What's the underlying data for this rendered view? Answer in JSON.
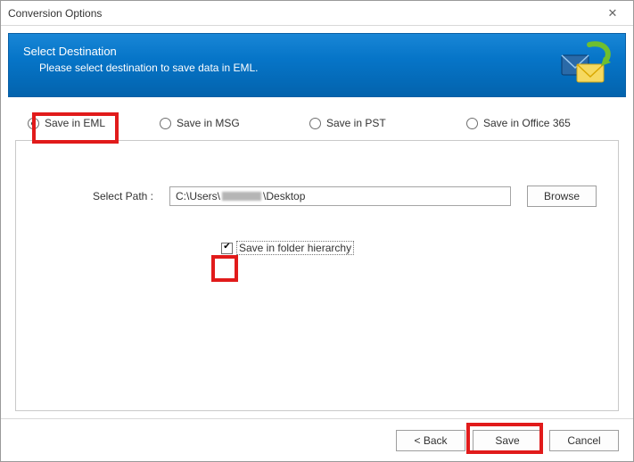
{
  "window": {
    "title": "Conversion Options"
  },
  "header": {
    "title": "Select Destination",
    "subtitle": "Please select destination to save data in EML."
  },
  "options": {
    "opt1": {
      "label": "Save in EML",
      "selected": true
    },
    "opt2": {
      "label": "Save in MSG",
      "selected": false
    },
    "opt3": {
      "label": "Save in PST",
      "selected": false
    },
    "opt4": {
      "label": "Save in Office 365",
      "selected": false
    }
  },
  "path": {
    "label": "Select Path :",
    "value_prefix": "C:\\Users\\",
    "value_suffix": "\\Desktop",
    "browse": "Browse"
  },
  "hierarchy": {
    "label": "Save in folder hierarchy",
    "checked": true
  },
  "buttons": {
    "back": "< Back",
    "save": "Save",
    "cancel": "Cancel"
  }
}
